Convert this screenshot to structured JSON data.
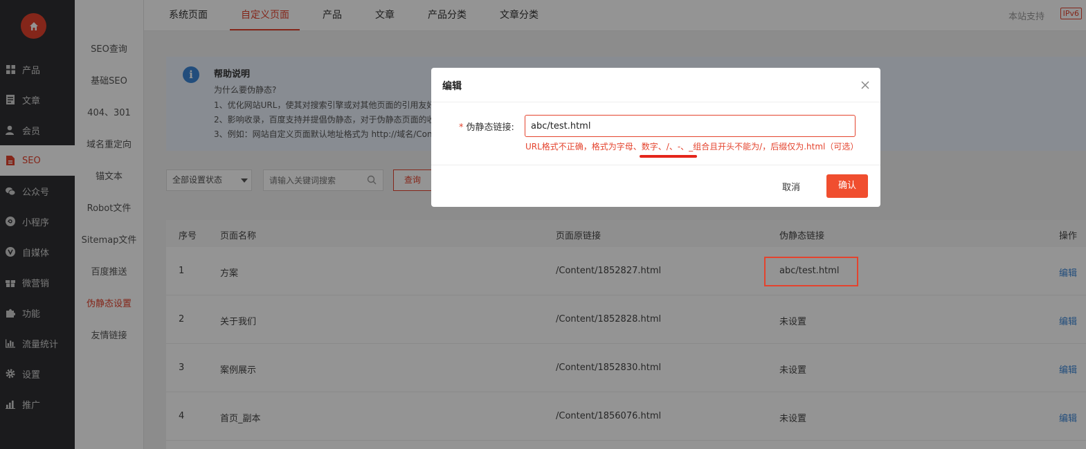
{
  "sidebar": {
    "items": [
      {
        "label": "产品",
        "icon": "grid-icon"
      },
      {
        "label": "文章",
        "icon": "document-icon"
      },
      {
        "label": "会员",
        "icon": "user-icon"
      },
      {
        "label": "SEO",
        "icon": "seo-icon"
      },
      {
        "label": "公众号",
        "icon": "wechat-icon"
      },
      {
        "label": "小程序",
        "icon": "miniapp-icon"
      },
      {
        "label": "自媒体",
        "icon": "media-icon"
      },
      {
        "label": "微营销",
        "icon": "gift-icon"
      },
      {
        "label": "功能",
        "icon": "puzzle-icon"
      },
      {
        "label": "流量统计",
        "icon": "bar-chart-icon"
      },
      {
        "label": "设置",
        "icon": "gear-icon"
      },
      {
        "label": "推广",
        "icon": "promote-icon"
      }
    ]
  },
  "subnav": {
    "items": [
      "SEO查询",
      "基础SEO",
      "404、301",
      "域名重定向",
      "锚文本",
      "Robot文件",
      "Sitemap文件",
      "百度推送",
      "伪静态设置",
      "友情链接"
    ]
  },
  "tabs": [
    "系统页面",
    "自定义页面",
    "产品",
    "文章",
    "产品分类",
    "文章分类"
  ],
  "header": {
    "support": "本站支持",
    "ipv6": "IPv6"
  },
  "help": {
    "title": "帮助说明",
    "lines": [
      "为什么要伪静态?",
      "1、优化网站URL，使其对搜索引擎或对其他页面的引用友好",
      "2、影响收录，百度支持并提倡伪静态，对于伪静态页面的收",
      "3、例如：网站自定义页面默认地址格式为 http://域名/Con"
    ]
  },
  "filters": {
    "status": "全部设置状态",
    "search_placeholder": "请输入关键词搜索",
    "query": "查询"
  },
  "table": {
    "headers": [
      "序号",
      "页面名称",
      "页面原链接",
      "伪静态链接",
      "操作"
    ],
    "rows": [
      {
        "no": "1",
        "name": "方案",
        "url": "/Content/1852827.html",
        "pseudo": "abc/test.html",
        "action": "编辑"
      },
      {
        "no": "2",
        "name": "关于我们",
        "url": "/Content/1852828.html",
        "pseudo": "未设置",
        "action": "编辑"
      },
      {
        "no": "3",
        "name": "案例展示",
        "url": "/Content/1852830.html",
        "pseudo": "未设置",
        "action": "编辑"
      },
      {
        "no": "4",
        "name": "首页_副本",
        "url": "/Content/1856076.html",
        "pseudo": "未设置",
        "action": "编辑"
      }
    ]
  },
  "modal": {
    "title": "编辑",
    "field_required": "*",
    "field_label": "伪静态链接:",
    "field_value": "abc/test.html",
    "error": "URL格式不正确，格式为字母、数字、/、-、_组合且开头不能为/，后缀仅为.html（可选）",
    "cancel": "取消",
    "confirm": "确认"
  },
  "colors": {
    "accent": "#e4432d",
    "sidebar_bg": "#2f3033",
    "link": "#3b86d6"
  }
}
